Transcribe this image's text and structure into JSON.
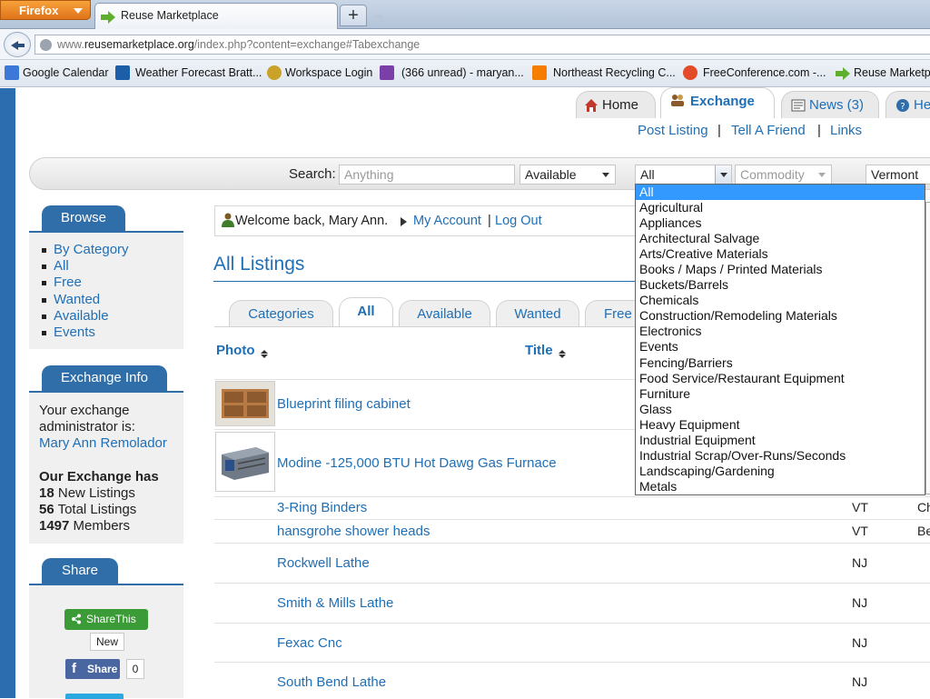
{
  "browser": {
    "menu_button": "Firefox",
    "tab_title": "Reuse Marketplace",
    "new_tab": "+",
    "blurred_title": "...",
    "url_prefix": "www.",
    "url_domain": "reusemarketplace.org",
    "url_path": "/index.php?content=exchange#Tabexchange"
  },
  "bookmarks": [
    {
      "label": "Google Calendar",
      "icon": "calendar-icon",
      "color": "#3c78d8"
    },
    {
      "label": "Weather Forecast Bratt...",
      "icon": "weather-icon",
      "color": "#1d5ea8"
    },
    {
      "label": "Workspace Login",
      "icon": "workspace-icon",
      "color": "#c9a227"
    },
    {
      "label": "(366 unread) - maryan...",
      "icon": "mail-icon",
      "color": "#7b3fa8"
    },
    {
      "label": "Northeast Recycling C...",
      "icon": "blogger-icon",
      "color": "#f57d00"
    },
    {
      "label": "FreeConference.com -...",
      "icon": "conference-icon",
      "color": "#e24a2a"
    },
    {
      "label": "Reuse Marketp",
      "icon": "arrow-icon",
      "color": "#5fae2e"
    }
  ],
  "site_nav": {
    "tabs": [
      {
        "label": "Home",
        "icon": "home-icon"
      },
      {
        "label": "Exchange",
        "icon": "exchange-icon"
      },
      {
        "label": "News (3)",
        "icon": "news-icon"
      },
      {
        "label": "He",
        "icon": "help-icon"
      }
    ],
    "sublinks": [
      "Post Listing",
      "|",
      "Tell A Friend",
      "|",
      "Links"
    ]
  },
  "search": {
    "label": "Search:",
    "placeholder": "Anything",
    "status_value": "Available",
    "category_value": "All",
    "commodity_placeholder": "Commodity",
    "state_value": "Vermont"
  },
  "category_options": [
    "All",
    "Agricultural",
    "Appliances",
    "Architectural Salvage",
    "Arts/Creative Materials",
    "Books / Maps / Printed Materials",
    "Buckets/Barrels",
    "Chemicals",
    "Construction/Remodeling Materials",
    "Electronics",
    "Events",
    "Fencing/Barriers",
    "Food Service/Restaurant Equipment",
    "Furniture",
    "Glass",
    "Heavy Equipment",
    "Industrial Equipment",
    "Industrial Scrap/Over-Runs/Seconds",
    "Landscaping/Gardening",
    "Metals"
  ],
  "sidebar": {
    "browse_header": "Browse",
    "browse_items": [
      "By Category",
      "All",
      "Free",
      "Wanted",
      "Available",
      "Events"
    ],
    "info_header": "Exchange Info",
    "admin_text_1": "Your exchange",
    "admin_text_2": "administrator is:",
    "admin_name": "Mary Ann Remolador",
    "stats_title": "Our Exchange has",
    "stats": [
      {
        "count": "18",
        "label": " New Listings"
      },
      {
        "count": "56",
        "label": " Total Listings"
      },
      {
        "count": "1497",
        "label": " Members"
      }
    ],
    "share_header": "Share",
    "sharethis_label": "ShareThis",
    "new_badge": "New",
    "fb_share_label": "Share",
    "fb_count": "0"
  },
  "main": {
    "welcome_text": "Welcome back, Mary Ann.",
    "my_account": "My Account",
    "separator": "|",
    "log_out": "Log Out",
    "title": "All Listings",
    "tabs": [
      "Categories",
      "All",
      "Available",
      "Wanted",
      "Free"
    ],
    "col_photo": "Photo",
    "col_title": "Title",
    "listings": [
      {
        "title": "Blueprint filing cabinet",
        "state": "",
        "extra": ""
      },
      {
        "title": "Modine -125,000 BTU Hot Dawg Gas Furnace",
        "state": "",
        "extra": ""
      },
      {
        "title": "3-Ring Binders",
        "state": "VT",
        "extra": "Ch"
      },
      {
        "title": "hansgrohe shower heads",
        "state": "VT",
        "extra": "Be"
      },
      {
        "title": "Rockwell Lathe",
        "state": "NJ",
        "extra": ""
      },
      {
        "title": "Smith & Mills Lathe",
        "state": "NJ",
        "extra": ""
      },
      {
        "title": "Fexac Cnc",
        "state": "NJ",
        "extra": ""
      },
      {
        "title": "South Bend Lathe",
        "state": "NJ",
        "extra": ""
      }
    ]
  }
}
